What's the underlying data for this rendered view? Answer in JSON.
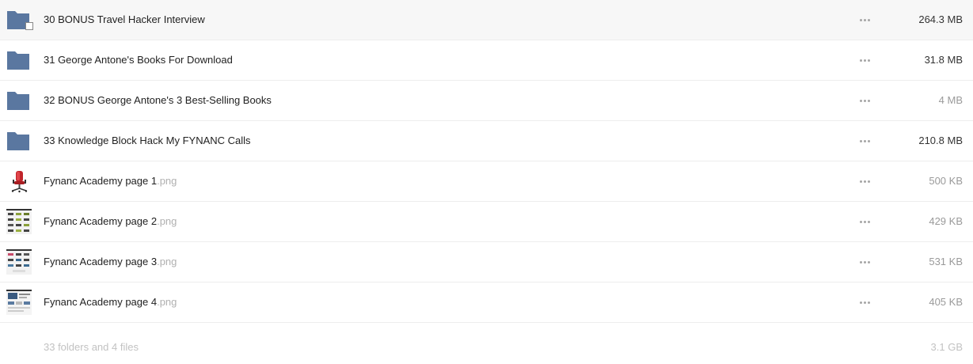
{
  "colors": {
    "folder": "#5a77a0",
    "folder_tab": "#4d6892",
    "row_border": "#ededed",
    "extension_text": "#b0b0b0",
    "summary_text": "#c2c2c2"
  },
  "rows": [
    {
      "type": "folder",
      "icon": "folder-icon",
      "name": "30 BONUS Travel Hacker Interview",
      "ext": "",
      "size": "264.3 MB",
      "selected": true
    },
    {
      "type": "folder",
      "icon": "folder-icon",
      "name": "31 George Antone's Books For Download",
      "ext": "",
      "size": "31.8 MB"
    },
    {
      "type": "folder",
      "icon": "folder-icon",
      "name": "32 BONUS George Antone's 3 Best-Selling Books",
      "ext": "",
      "size": "4 MB"
    },
    {
      "type": "folder",
      "icon": "folder-icon",
      "name": "33 Knowledge Block Hack My FYNANC Calls",
      "ext": "",
      "size": "210.8 MB"
    },
    {
      "type": "image",
      "icon": "chair-thumbnail",
      "name": "Fynanc Academy page 1",
      "ext": ".png",
      "size": "500 KB"
    },
    {
      "type": "image",
      "icon": "webpage-thumbnail",
      "name": "Fynanc Academy page 2",
      "ext": ".png",
      "size": "429 KB"
    },
    {
      "type": "image",
      "icon": "webpage-thumbnail",
      "name": "Fynanc Academy page 3",
      "ext": ".png",
      "size": "531 KB"
    },
    {
      "type": "image",
      "icon": "webpage-thumbnail",
      "name": "Fynanc Academy page 4",
      "ext": ".png",
      "size": "405 KB"
    }
  ],
  "summary": {
    "text": "33 folders and 4 files",
    "total_size": "3.1 GB"
  }
}
